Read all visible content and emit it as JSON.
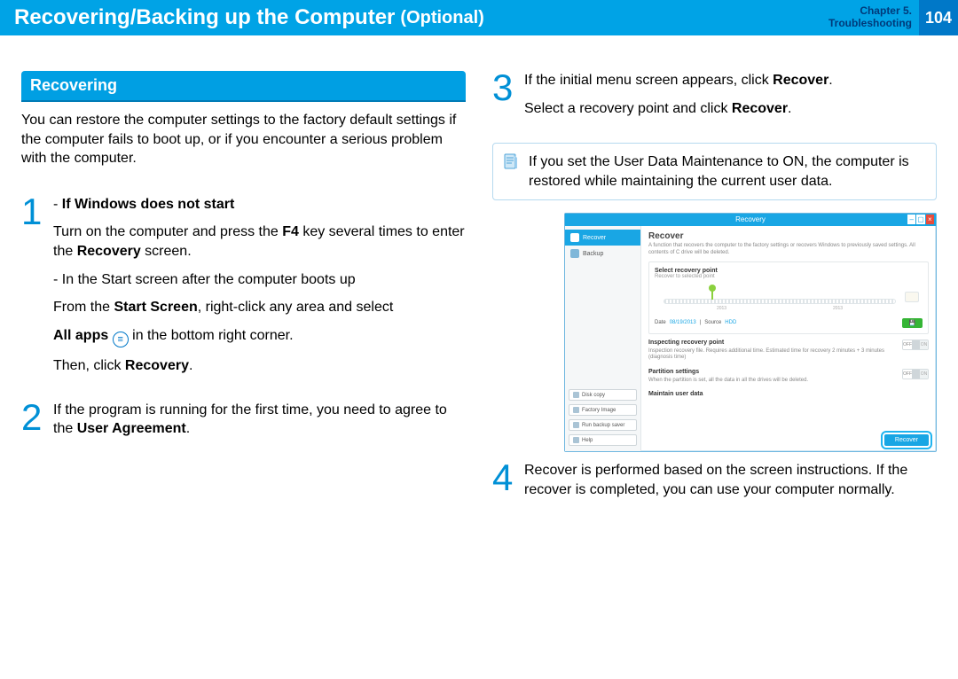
{
  "header": {
    "title": "Recovering/Backing up the Computer",
    "subtitle": "(Optional)",
    "chapter_line1": "Chapter 5.",
    "chapter_line2": "Troubleshooting",
    "page": "104"
  },
  "section_label": "Recovering",
  "intro": "You can restore the computer settings to the factory default settings if the computer fails to boot up, or if you encounter a serious problem with the computer.",
  "step1": {
    "num": "1",
    "line1_bold": "If Windows does not start",
    "line2a": "Turn on the computer and press the ",
    "line2_key": "F4",
    "line2b": " key several times to enter the ",
    "line2_bold": "Recovery",
    "line2c": " screen.",
    "line3": "In the Start screen after the computer boots up",
    "line4a": "From the ",
    "line4_bold": "Start Screen",
    "line4b": ", right-click any area and select",
    "line5a": "All apps",
    "line5b": " in the bottom right corner.",
    "line6a": "Then, click ",
    "line6_bold": "Recovery",
    "line6b": "."
  },
  "step2": {
    "num": "2",
    "text_a": "If the program is running for the first time, you need to agree to the ",
    "text_bold": "User Agreement",
    "text_b": "."
  },
  "step3": {
    "num": "3",
    "line1a": "If the initial menu screen appears, click ",
    "line1_bold": "Recover",
    "line1b": ".",
    "line2a": "Select a recovery point and click ",
    "line2_bold": "Recover",
    "line2b": "."
  },
  "info": "If you set the User Data Maintenance to ON, the computer is restored while maintaining the current user data.",
  "step4": {
    "num": "4",
    "text": "Recover is performed based on the screen instructions. If the recover is completed, you can use your computer normally."
  },
  "app": {
    "title": "Recovery",
    "side_recover": "Recover",
    "side_backup": "Backup",
    "side_disk": "Disk copy",
    "side_img": "Factory Image",
    "side_run": "Run backup saver",
    "side_help": "Help",
    "main_title": "Recover",
    "main_desc": "A function that recovers the computer to the factory settings or recovers Windows to previously saved settings. All contents of C drive will be deleted.",
    "panel1_title": "Select recovery point",
    "panel1_sub": "Recover to selected point",
    "year_a": "2013",
    "year_b": "2013",
    "meta_date_l": "Date",
    "meta_date_v": "08/19/2013",
    "meta_src_l": "Source",
    "meta_src_v": "HDD",
    "row_insp_t": "Inspecting recovery point",
    "row_insp_d": "Inspection recovery file. Requires additional time. Estimated time for recovery 2 minutes + 3 minutes (diagnosis time)",
    "row_part_t": "Partition settings",
    "row_part_d": "When the partition is set, all the data in all the drives will be deleted.",
    "row_user_t": "Maintain user data",
    "sw_off": "OFF",
    "sw_on": "ON",
    "recover_btn": "Recover"
  }
}
